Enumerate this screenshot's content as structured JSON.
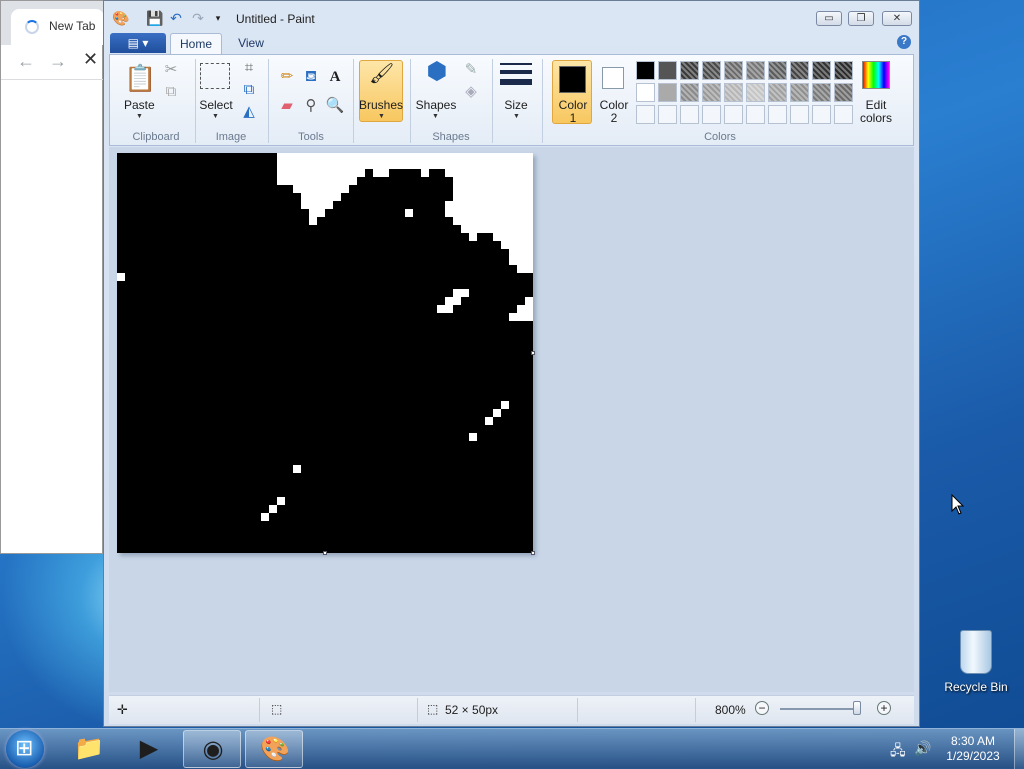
{
  "browser": {
    "tab_title": "New Tab",
    "back_icon": "←",
    "forward_icon": "→",
    "stop_icon": "✕"
  },
  "paint": {
    "title": "Untitled - Paint",
    "window_buttons": {
      "minimize": "▭",
      "restore": "❐",
      "close": "✕"
    },
    "file_button": "▤ ▾",
    "tabs": [
      {
        "label": "Home",
        "active": true
      },
      {
        "label": "View",
        "active": false
      }
    ],
    "help": "?",
    "groups": {
      "clipboard": {
        "label": "Clipboard",
        "paste": "Paste"
      },
      "image": {
        "label": "Image",
        "select": "Select"
      },
      "tools": {
        "label": "Tools"
      },
      "brushes": {
        "label": "Brushes"
      },
      "shapes": {
        "label": "Shapes",
        "shapes_button": "Shapes"
      },
      "size": {
        "label": "Size"
      },
      "colors": {
        "label": "Colors",
        "color1": "Color 1",
        "color1_line1": "Color",
        "color1_line2": "1",
        "color2_line1": "Color",
        "color2_line2": "2",
        "edit_line1": "Edit",
        "edit_line2": "colors",
        "color1_value": "#000000",
        "color2_value": "#ffffff"
      }
    },
    "palette_row1": [
      "#000000",
      "#555555",
      "#3a3a3a",
      "#4a4a4a",
      "#6a6a6a",
      "#777777",
      "#5c5c5c",
      "#444444",
      "#333333",
      "#2b2b2b"
    ],
    "palette_row2": [
      "#ffffff",
      "#aaaaaa",
      "#8a8a8a",
      "#9a9a9a",
      "#b5b5b5",
      "#c5c5c5",
      "#a0a0a0",
      "#909090",
      "#7a7a7a",
      "#6a6a6a"
    ],
    "status": {
      "dimensions": "52 × 50px",
      "zoom": "800%"
    }
  },
  "desktop": {
    "recycle_bin": "Recycle Bin"
  },
  "taskbar": {
    "time": "8:30 AM",
    "date": "1/29/2023"
  }
}
